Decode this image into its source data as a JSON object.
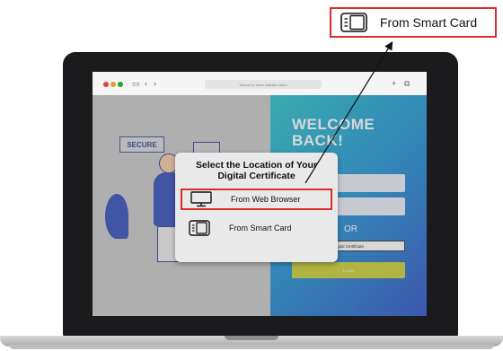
{
  "browser": {
    "address_placeholder": "Search or enter website name",
    "plus_icon": "+",
    "tabs_icon": "⧉"
  },
  "login_page": {
    "secure_sign": "SECURE",
    "welcome_line1": "WELCOME",
    "welcome_line2": "BACK!",
    "or_text": "OR",
    "digital_certificate_button": "Digital Certificate",
    "login_button": "LOGIN"
  },
  "modal": {
    "title": "Select the Location of Your Digital Certificate",
    "options": [
      {
        "label": "From Web Browser",
        "icon": "monitor-icon",
        "selected": true
      },
      {
        "label": "From Smart Card",
        "icon": "smart-card-icon",
        "selected": false
      }
    ]
  },
  "callout": {
    "label": "From Smart Card",
    "icon": "smart-card-icon"
  },
  "colors": {
    "highlight": "#e02b2b",
    "accent_blue": "#2a4fc6",
    "accent_teal": "#24c2c9",
    "login_button": "#c9cf2e"
  }
}
